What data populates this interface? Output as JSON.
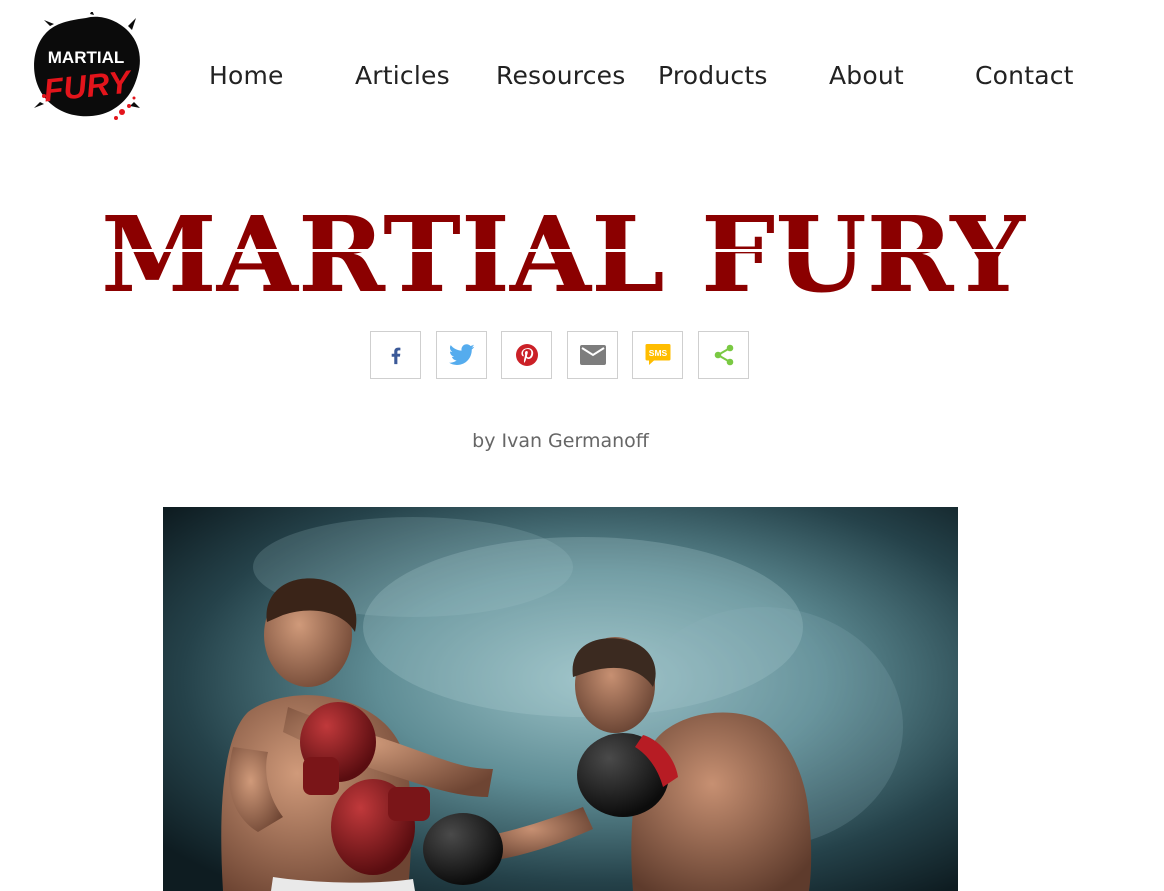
{
  "logo": {
    "line1": "MARTIAL",
    "line2": "FURY",
    "colors": {
      "splash": "#0b0b0b",
      "text": "#ffffff",
      "accent": "#e3141b"
    }
  },
  "nav": {
    "items": [
      {
        "label": "Home"
      },
      {
        "label": "Articles"
      },
      {
        "label": "Resources"
      },
      {
        "label": "Products"
      },
      {
        "label": "About"
      },
      {
        "label": "Contact"
      }
    ]
  },
  "title": {
    "text": "MARTIAL FURY",
    "color": "#8b0000"
  },
  "share": {
    "buttons": [
      {
        "icon": "facebook-icon",
        "color": "#3b5998"
      },
      {
        "icon": "twitter-icon",
        "color": "#55acee"
      },
      {
        "icon": "pinterest-icon",
        "color": "#cb2027"
      },
      {
        "icon": "email-icon",
        "color": "#7d7d7d"
      },
      {
        "icon": "sms-icon",
        "color": "#ffbd00",
        "label": "SMS"
      },
      {
        "icon": "share-icon",
        "color": "#7ac943"
      }
    ]
  },
  "byline": "by Ivan Germanoff",
  "hero": {
    "subject": "Two shirtless boxers sparring in boxing gloves against a smoky teal background"
  }
}
